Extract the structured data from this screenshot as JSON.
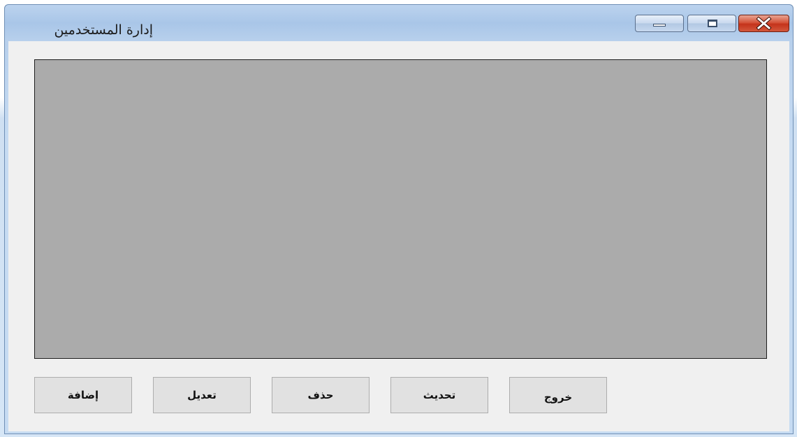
{
  "window": {
    "title": "إدارة المستخدمين",
    "controls": {
      "minimize_icon": "minimize-icon",
      "maximize_icon": "maximize-icon",
      "close_icon": "close-icon"
    }
  },
  "main": {
    "grid": {
      "rows": []
    }
  },
  "buttons": {
    "add": "إضافة",
    "edit": "تعديل",
    "delete": "حذف",
    "refresh": "تحديث",
    "exit": "خروج"
  },
  "colors": {
    "grid_background": "#ababab",
    "client_background": "#f0f0f0",
    "close_button": "#c4331b"
  }
}
